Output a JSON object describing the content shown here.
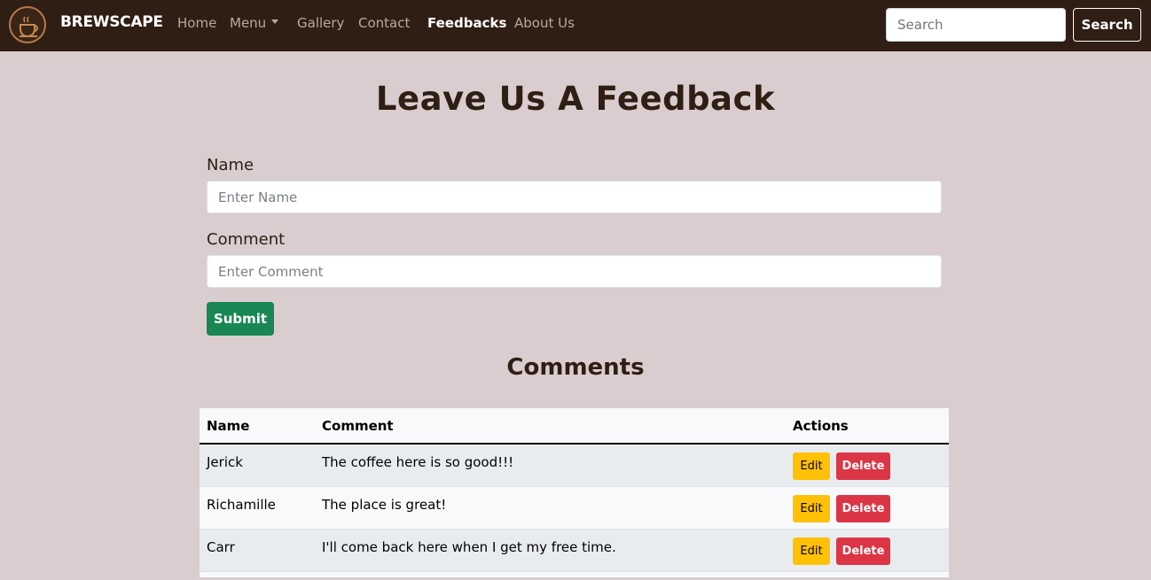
{
  "navbar": {
    "brand": "BREWSCAPE",
    "logo_icon": "coffee-cup-icon",
    "items": [
      {
        "label": "Home"
      },
      {
        "label": "Menu"
      },
      {
        "label": "Gallery"
      },
      {
        "label": "Contact"
      },
      {
        "label": "Feedbacks"
      },
      {
        "label": "About Us"
      }
    ],
    "active_item": "Feedbacks",
    "search": {
      "placeholder": "Search",
      "value": "",
      "button_label": "Search"
    }
  },
  "page": {
    "title": "Leave Us A Feedback"
  },
  "form": {
    "name_label": "Name",
    "name_placeholder": "Enter Name",
    "name_value": "",
    "comment_label": "Comment",
    "comment_placeholder": "Enter Comment",
    "comment_value": "",
    "submit_label": "Submit"
  },
  "comments": {
    "title": "Comments",
    "columns": [
      "Name",
      "Comment",
      "Actions"
    ],
    "rows": [
      {
        "name": "Jerick",
        "comment": "The coffee here is so good!!!",
        "edit": "Edit",
        "delete": "Delete"
      },
      {
        "name": "Richamille",
        "comment": "The place is great!",
        "edit": "Edit",
        "delete": "Delete"
      },
      {
        "name": "Carr",
        "comment": "I'll come back here when I get my free time.",
        "edit": "Edit",
        "delete": "Delete"
      }
    ]
  },
  "colors": {
    "navbar_bg": "#2f1e13",
    "page_bg": "#dacdcf",
    "submit": "#198754",
    "edit": "#ffc107",
    "delete": "#dc3545"
  }
}
